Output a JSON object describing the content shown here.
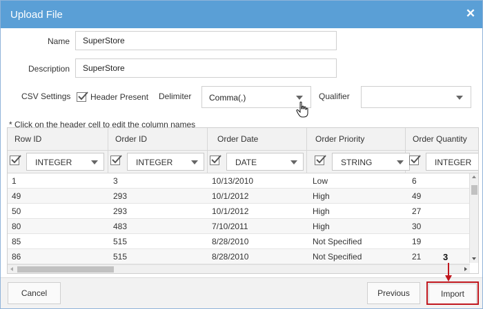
{
  "dialog": {
    "title": "Upload File",
    "close_glyph": "✕"
  },
  "form": {
    "name_label": "Name",
    "name_value": "SuperStore",
    "description_label": "Description",
    "description_value": "SuperStore",
    "csv_settings_label": "CSV Settings",
    "header_present_label": "Header Present",
    "header_present_checked": true,
    "delimiter_label": "Delimiter",
    "delimiter_value": "Comma(,)",
    "qualifier_label": "Qualifier",
    "qualifier_value": ""
  },
  "grid": {
    "note": "* Click on the header cell to edit the column names",
    "columns": [
      {
        "header": "Row ID",
        "type": "INTEGER"
      },
      {
        "header": "Order ID",
        "type": "INTEGER"
      },
      {
        "header": "Order Date",
        "type": "DATE"
      },
      {
        "header": "Order Priority",
        "type": "STRING"
      },
      {
        "header": "Order Quantity",
        "type": "INTEGER"
      }
    ],
    "rows": [
      [
        "1",
        "3",
        "10/13/2010",
        "Low",
        "6"
      ],
      [
        "49",
        "293",
        "10/1/2012",
        "High",
        "49"
      ],
      [
        "50",
        "293",
        "10/1/2012",
        "High",
        "27"
      ],
      [
        "80",
        "483",
        "7/10/2011",
        "High",
        "30"
      ],
      [
        "85",
        "515",
        "8/28/2010",
        "Not Specified",
        "19"
      ],
      [
        "86",
        "515",
        "8/28/2010",
        "Not Specified",
        "21"
      ]
    ]
  },
  "footer": {
    "cancel_label": "Cancel",
    "previous_label": "Previous",
    "import_label": "Import"
  },
  "annotation": {
    "step_number": "3",
    "color": "#c0161d"
  },
  "colors": {
    "titlebar": "#5a9fd6",
    "highlight": "#c0161d"
  }
}
